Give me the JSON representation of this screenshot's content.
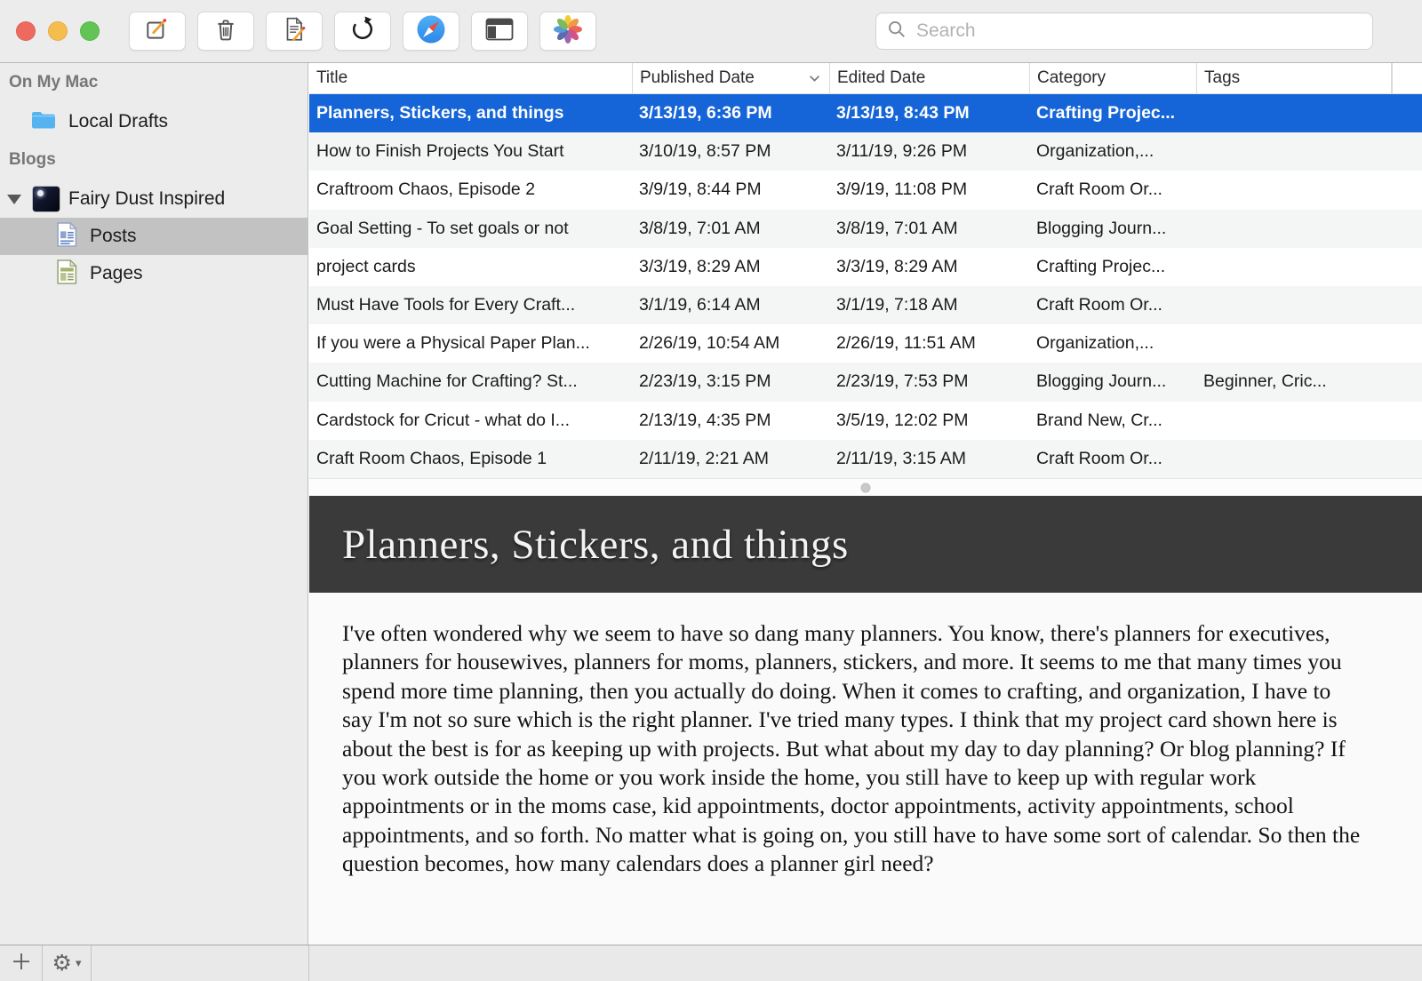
{
  "toolbar": {
    "traffic_lights": [
      "close",
      "minimize",
      "zoom"
    ],
    "buttons": [
      {
        "name": "compose",
        "icon": "compose-icon"
      },
      {
        "name": "trash",
        "icon": "trash-icon"
      },
      {
        "name": "edit-post",
        "icon": "document-edit-icon"
      },
      {
        "name": "refresh",
        "icon": "refresh-icon"
      },
      {
        "name": "open-in-browser",
        "icon": "safari-compass-icon"
      },
      {
        "name": "view-layout",
        "icon": "columns-layout-icon"
      },
      {
        "name": "media-browser",
        "icon": "photos-flower-icon"
      }
    ],
    "search": {
      "placeholder": "Search",
      "icon": "search-icon"
    }
  },
  "sidebar": {
    "sections": [
      {
        "header": "On My Mac",
        "items": [
          {
            "label": "Local Drafts",
            "icon": "folder-icon"
          }
        ]
      },
      {
        "header": "Blogs",
        "items": [
          {
            "label": "Fairy Dust Inspired",
            "icon": "blog-favicon",
            "expanded": true
          },
          {
            "label": "Posts",
            "icon": "posts-document-icon",
            "selected": true
          },
          {
            "label": "Pages",
            "icon": "pages-document-icon"
          }
        ]
      }
    ]
  },
  "table": {
    "columns": [
      {
        "label": "Title"
      },
      {
        "label": "Published Date",
        "sort": "desc"
      },
      {
        "label": "Edited Date"
      },
      {
        "label": "Category"
      },
      {
        "label": "Tags"
      }
    ],
    "rows": [
      {
        "title": "Planners, Stickers, and things",
        "published": "3/13/19, 6:36 PM",
        "edited": "3/13/19, 8:43 PM",
        "category": "Crafting Projec...",
        "tags": "",
        "selected": true
      },
      {
        "title": "How to Finish Projects You Start",
        "published": "3/10/19, 8:57 PM",
        "edited": "3/11/19, 9:26 PM",
        "category": "Organization,...",
        "tags": ""
      },
      {
        "title": "Craftroom Chaos, Episode 2",
        "published": "3/9/19, 8:44 PM",
        "edited": "3/9/19, 11:08 PM",
        "category": "Craft Room Or...",
        "tags": ""
      },
      {
        "title": "Goal Setting - To set goals or not",
        "published": "3/8/19, 7:01 AM",
        "edited": "3/8/19, 7:01 AM",
        "category": "Blogging Journ...",
        "tags": ""
      },
      {
        "title": "project cards",
        "published": "3/3/19, 8:29 AM",
        "edited": "3/3/19, 8:29 AM",
        "category": "Crafting Projec...",
        "tags": ""
      },
      {
        "title": "Must Have Tools for Every Craft...",
        "published": "3/1/19, 6:14 AM",
        "edited": "3/1/19, 7:18 AM",
        "category": "Craft Room Or...",
        "tags": ""
      },
      {
        "title": "If you were a Physical Paper Plan...",
        "published": "2/26/19, 10:54 AM",
        "edited": "2/26/19, 11:51 AM",
        "category": "Organization,...",
        "tags": ""
      },
      {
        "title": "Cutting Machine for Crafting? St...",
        "published": "2/23/19, 3:15 PM",
        "edited": "2/23/19, 7:53 PM",
        "category": "Blogging Journ...",
        "tags": "Beginner,  Cric..."
      },
      {
        "title": "Cardstock for Cricut - what do I...",
        "published": "2/13/19, 4:35 PM",
        "edited": "3/5/19, 12:02 PM",
        "category": "Brand New, Cr...",
        "tags": ""
      },
      {
        "title": "Craft Room Chaos, Episode 1",
        "published": "2/11/19, 2:21 AM",
        "edited": "2/11/19, 3:15 AM",
        "category": "Craft Room Or...",
        "tags": ""
      }
    ]
  },
  "preview": {
    "title": "Planners, Stickers, and things",
    "body": "I've often wondered why we seem to have so dang many planners. You know, there's planners for executives, planners for housewives, planners for moms, planners, stickers, and more. It seems to me that many times you spend more time planning, then you actually do doing. When it comes to crafting, and organization, I have to say I'm not so sure which is the right planner. I've tried many types. I think that my project card shown here is about the best is for as keeping up with projects. But what about my day to day planning? Or blog planning? If you work outside the home or you work inside the home, you still have to keep up with regular work appointments or in the moms case, kid appointments, doctor appointments, activity appointments, school appointments, and so forth. No matter what is going on, you still have to have some sort of calendar. So then the question becomes, how many calendars does a planner girl need?"
  },
  "footer": {
    "buttons": [
      {
        "name": "add",
        "icon": "plus-icon"
      },
      {
        "name": "actions",
        "icon": "gear-icon",
        "caret": "▾"
      }
    ],
    "gear_glyph": "⚙",
    "caret_glyph": "▾"
  },
  "colors": {
    "selection_blue": "#1565d8",
    "preview_header": "#3a3a3a",
    "sidebar_selection": "#c2c2c2",
    "toolbar_bg": "#ececec"
  }
}
